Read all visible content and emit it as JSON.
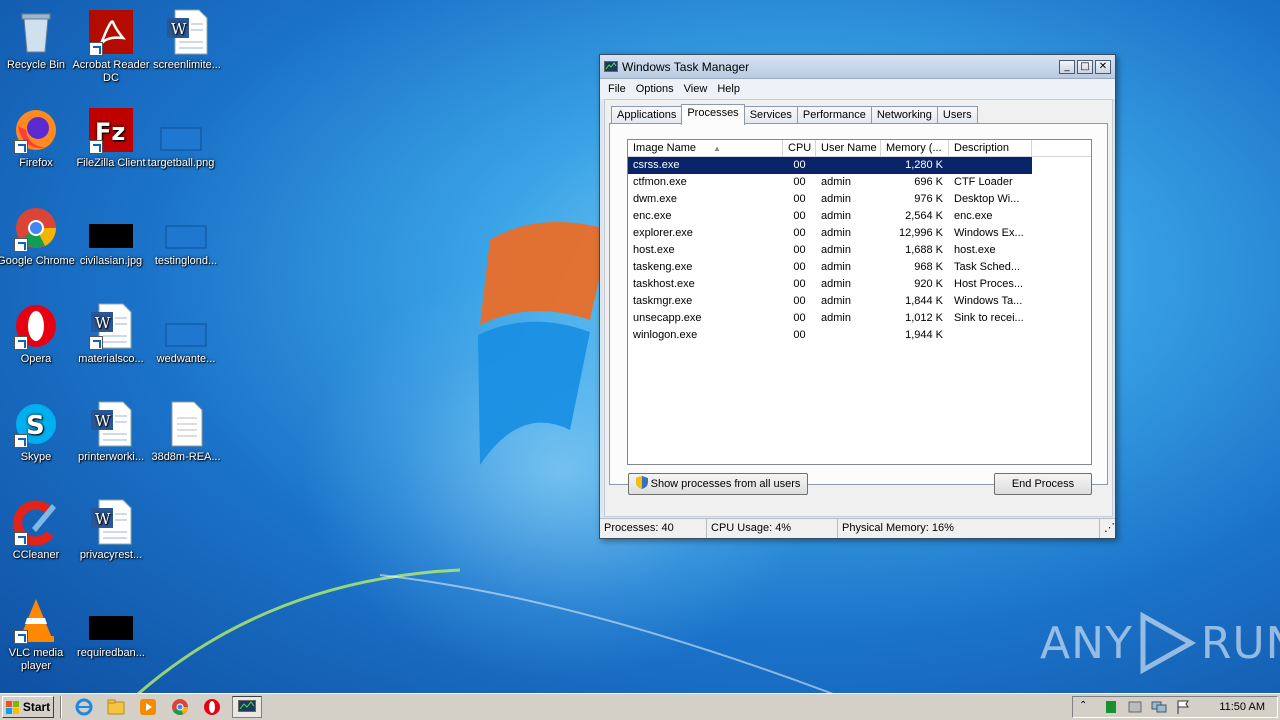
{
  "desktop": {
    "icons": [
      {
        "label": "Recycle Bin"
      },
      {
        "label": "Acrobat Reader DC"
      },
      {
        "label": "screenlimite..."
      },
      {
        "label": "Firefox"
      },
      {
        "label": "FileZilla Client"
      },
      {
        "label": "targetball.png"
      },
      {
        "label": "Google Chrome"
      },
      {
        "label": "civilasian.jpg"
      },
      {
        "label": "testinglond..."
      },
      {
        "label": "Opera"
      },
      {
        "label": "materialsco..."
      },
      {
        "label": "wedwante..."
      },
      {
        "label": "Skype"
      },
      {
        "label": "printerworki..."
      },
      {
        "label": "38d8m-REA..."
      },
      {
        "label": "CCleaner"
      },
      {
        "label": "privacyrest..."
      },
      {
        "label": "VLC media player"
      },
      {
        "label": "requiredban..."
      }
    ]
  },
  "window": {
    "title": "Windows Task Manager",
    "controls": {
      "minimize": "_",
      "maximize": "□",
      "close": "✕"
    },
    "menu": [
      "File",
      "Options",
      "View",
      "Help"
    ],
    "tabs": [
      "Applications",
      "Processes",
      "Services",
      "Performance",
      "Networking",
      "Users"
    ],
    "active_tab": "Processes",
    "columns": [
      "Image Name",
      "CPU",
      "User Name",
      "Memory (...",
      "Description"
    ],
    "sort_indicator": "▲",
    "processes": [
      {
        "name": "csrss.exe",
        "cpu": "00",
        "user": "",
        "memory": "1,280 K",
        "desc": ""
      },
      {
        "name": "ctfmon.exe",
        "cpu": "00",
        "user": "admin",
        "memory": "696 K",
        "desc": "CTF Loader"
      },
      {
        "name": "dwm.exe",
        "cpu": "00",
        "user": "admin",
        "memory": "976 K",
        "desc": "Desktop Wi..."
      },
      {
        "name": "enc.exe",
        "cpu": "00",
        "user": "admin",
        "memory": "2,564 K",
        "desc": "enc.exe"
      },
      {
        "name": "explorer.exe",
        "cpu": "00",
        "user": "admin",
        "memory": "12,996 K",
        "desc": "Windows Ex..."
      },
      {
        "name": "host.exe",
        "cpu": "00",
        "user": "admin",
        "memory": "1,688 K",
        "desc": "host.exe"
      },
      {
        "name": "taskeng.exe",
        "cpu": "00",
        "user": "admin",
        "memory": "968 K",
        "desc": "Task Sched..."
      },
      {
        "name": "taskhost.exe",
        "cpu": "00",
        "user": "admin",
        "memory": "920 K",
        "desc": "Host Proces..."
      },
      {
        "name": "taskmgr.exe",
        "cpu": "00",
        "user": "admin",
        "memory": "1,844 K",
        "desc": "Windows Ta..."
      },
      {
        "name": "unsecapp.exe",
        "cpu": "00",
        "user": "admin",
        "memory": "1,012 K",
        "desc": "Sink to recei..."
      },
      {
        "name": "winlogon.exe",
        "cpu": "00",
        "user": "",
        "memory": "1,944 K",
        "desc": ""
      }
    ],
    "show_all_button": "Show processes from all users",
    "end_process_button": "End Process",
    "status": {
      "processes": "Processes: 40",
      "cpu": "CPU Usage: 4%",
      "memory": "Physical Memory: 16%"
    }
  },
  "taskbar": {
    "start_label": "Start",
    "clock": "11:50 AM"
  },
  "watermark": {
    "left": "ANY",
    "right": "RUN"
  },
  "colors": {
    "selection": "#0a246a",
    "taskbar": "#d4d0c8",
    "desktop": "#1b73c9"
  }
}
